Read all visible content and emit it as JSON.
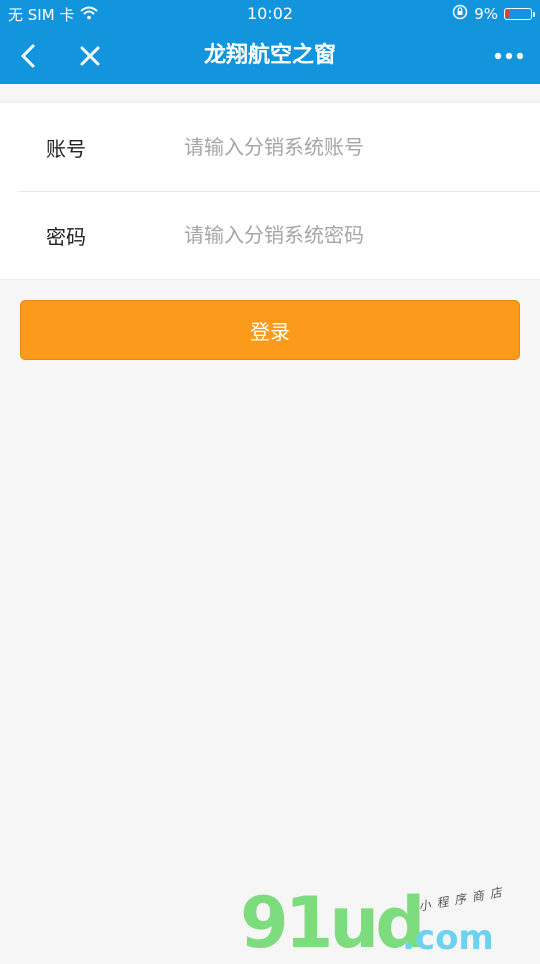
{
  "status_bar": {
    "carrier": "无 SIM 卡",
    "time": "10:02",
    "battery_percent": "9%",
    "battery_level": 0.09,
    "battery_color": "#e23b2f"
  },
  "navbar": {
    "title": "龙翔航空之窗",
    "back_icon": "chevron-left-icon",
    "close_icon": "close-icon",
    "more_icon": "more-dots-icon",
    "background": "#1295dc"
  },
  "form": {
    "account": {
      "label": "账号",
      "placeholder": "请输入分销系统账号",
      "value": ""
    },
    "password": {
      "label": "密码",
      "placeholder": "请输入分销系统密码",
      "value": ""
    }
  },
  "login_button": {
    "label": "登录",
    "color": "#fb9a1b"
  },
  "watermark": {
    "main": "91ud",
    "domain": ".com",
    "sub": "小程序商店"
  }
}
